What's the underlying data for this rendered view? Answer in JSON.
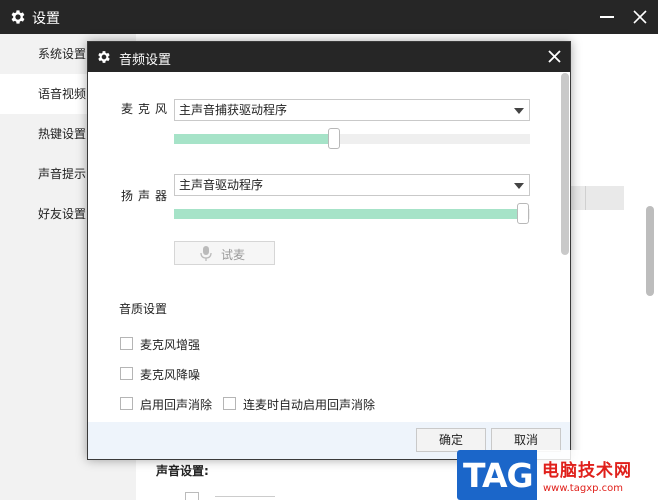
{
  "window": {
    "title": "设置",
    "icons": {
      "settings": "gear-icon",
      "minimize": "minimize-icon",
      "close": "close-icon"
    }
  },
  "sidebar": {
    "items": [
      {
        "label": "系统设置"
      },
      {
        "label": "语音视频",
        "active": true
      },
      {
        "label": "热键设置"
      },
      {
        "label": "声音提示"
      },
      {
        "label": "好友设置"
      }
    ]
  },
  "main": {
    "sound_settings_label": "声音设置:"
  },
  "dialog": {
    "title": "音频设置",
    "microphone": {
      "label": "麦克风",
      "device": "主声音捕获驱动程序",
      "volume": 0.45
    },
    "speaker": {
      "label": "扬声器",
      "device": "主声音驱动程序",
      "volume": 0.98
    },
    "test_button": "试麦",
    "quality": {
      "title": "音质设置",
      "options": [
        {
          "label": "麦克风增强",
          "checked": false
        },
        {
          "label": "麦克风降噪",
          "checked": false
        },
        {
          "label": "启用回声消除",
          "checked": false
        },
        {
          "label": "连麦时自动启用回声消除",
          "checked": false
        }
      ]
    },
    "footer": {
      "confirm": "确定",
      "cancel": "取消"
    }
  },
  "watermark": {
    "tag": "TAG",
    "site_name": "电脑技术网",
    "url": "www.tagxp.com"
  },
  "colors": {
    "titlebar": "#262626",
    "slider_fill": "#a6e3c8",
    "footer_bg": "#eef4fb",
    "watermark_blue": "#1b66c9",
    "watermark_red": "#e0201b"
  }
}
